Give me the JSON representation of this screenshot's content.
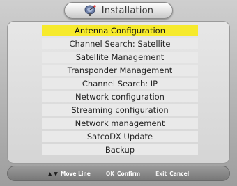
{
  "header": {
    "title": "Installation",
    "icon": "satellite-dish-icon"
  },
  "menu": {
    "selected_index": 0,
    "items": [
      "Antenna Configuration",
      "Channel Search: Satellite",
      "Satellite Management",
      "Transponder Management",
      "Channel Search: IP",
      "Network configuration",
      "Streaming configuration",
      "Network management",
      "SatcoDX Update",
      "Backup"
    ]
  },
  "footer": {
    "move": {
      "key": "▲ ▼",
      "label": "Move Line"
    },
    "confirm": {
      "key": "OK",
      "label": "Confirm"
    },
    "cancel": {
      "key": "Exit",
      "label": "Cancel"
    }
  },
  "colors": {
    "highlight": "#f6ea2c",
    "item_background": "#e9e9e9",
    "footer": "#888888"
  }
}
